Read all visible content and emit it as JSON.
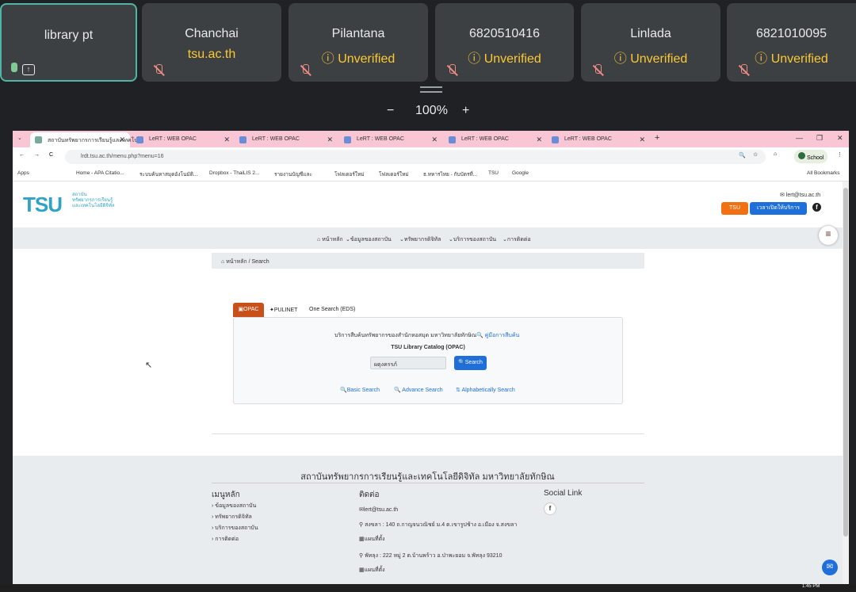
{
  "meet": {
    "tiles": [
      {
        "name": "library pt",
        "sub": ""
      },
      {
        "name": "Chanchai",
        "sub": "tsu.ac.th"
      },
      {
        "name": "Pilantana",
        "sub": "Unverified"
      },
      {
        "name": "6820510416",
        "sub": "Unverified"
      },
      {
        "name": "Linlada",
        "sub": "Unverified"
      },
      {
        "name": "6821010095",
        "sub": "Unverified"
      }
    ],
    "zoom_minus": "−",
    "zoom_level": "100%",
    "zoom_plus": "+"
  },
  "browser": {
    "tabs": [
      {
        "label": "สถาบันทรัพยากรการเรียนรู้และเทคโนโ"
      },
      {
        "label": "LeRT : WEB OPAC"
      },
      {
        "label": "LeRT : WEB OPAC"
      },
      {
        "label": "LeRT : WEB OPAC"
      },
      {
        "label": "LeRT : WEB OPAC"
      },
      {
        "label": "LeRT : WEB OPAC"
      }
    ],
    "url": "lrdt.tsu.ac.th/menu.php?menu=16",
    "profile": "School",
    "bookmarks": [
      "Apps",
      "Home - APA Citatio...",
      "ระบบค้นหาสมุดอังโนมัติ...",
      "Dropbox - ThaiLIS 2...",
      "รายงานบัญชีและ",
      "โฟลเดอร์ใหม่",
      "โฟลเดอร์ใหม่",
      "ธ.ทหารไทย - กับบัตรที่...",
      "TSU",
      "Google"
    ],
    "all_bookmarks": "All Bookmarks"
  },
  "site": {
    "logo_text": "TSU",
    "logo_line1": "สถาบัน",
    "logo_line2": "ทรัพยากรการเรียนรู้",
    "logo_line3": "และเทคโนโลยีดิจิทัล",
    "email": "lert@tsu.ac.th",
    "btn_tsu": "TSU",
    "btn_hours": "เวลาเปิดให้บริการ",
    "nav": [
      "หน้าหลัก",
      "ข้อมูลของสถาบัน",
      "ทรัพยากรดิจิทัล",
      "บริการของสถาบัน",
      "การติดต่อ"
    ],
    "breadcrumb_home": "หน้าหลัก",
    "breadcrumb_current": "/ Search",
    "search_tabs": [
      "OPAC",
      "PULINET",
      "One Search (EDS)"
    ],
    "search_desc": "บริการสืบค้นทรัพยากรของสำนักหอสมุด มหาวิทยาลัยทักษิณ",
    "search_manual": "คู่มือการสืบค้น",
    "catalog_title": "TSU Library Catalog (OPAC)",
    "search_value": "ผดุงครรภ์",
    "search_button": "Search",
    "links": [
      "Basic Search",
      "Advance Search",
      "Alphabetically Search"
    ],
    "footer_title": "สถาบันทรัพยากรการเรียนรู้และเทคโนโลยีดิจิทัล มหาวิทยาลัยทักษิณ",
    "footer_menu_title": "เมนูหลัก",
    "footer_menu": [
      "ข้อมูลของสถาบัน",
      "ทรัพยากรดิจิทัล",
      "บริการของสถาบัน",
      "การติดต่อ"
    ],
    "footer_contact_title": "ติดต่อ",
    "footer_email": "lert@tsu.ac.th",
    "footer_addr1": "สงขลา : 140 ถ.กาญจนวณิชย์ ม.4 ต.เขารูปช้าง อ.เมือง จ.สงขลา",
    "footer_map1": "แผนที่ตั้ง",
    "footer_addr2": "พัทลุง : 222 หมู่ 2 ต.บ้านพร้าว อ.ป่าพะยอม จ.พัทลุง 93210",
    "footer_map2": "แผนที่ตั้ง",
    "footer_social_title": "Social Link",
    "time": "1:45 PM"
  }
}
